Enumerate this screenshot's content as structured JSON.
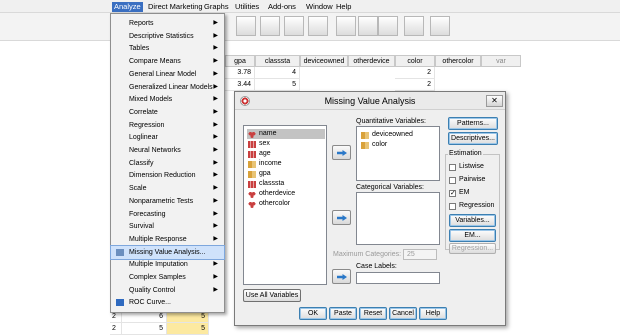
{
  "menubar": {
    "items": [
      "Analyze",
      "Direct Marketing",
      "Graphs",
      "Utilities",
      "Add-ons",
      "Window",
      "Help"
    ]
  },
  "grid": {
    "columns": [
      "gpa",
      "classsta",
      "deviceowned",
      "otherdevice",
      "color",
      "othercolor",
      "var"
    ],
    "rows": [
      {
        "gpa": "3.78",
        "classsta": "4",
        "color": "2"
      },
      {
        "gpa": "3.44",
        "classsta": "5",
        "color": "2"
      }
    ],
    "bottom_rows": [
      {
        "c1": "2",
        "c2": "6",
        "c3": "5"
      },
      {
        "c1": "2",
        "c2": "5",
        "c3": "5"
      }
    ]
  },
  "analyze_menu": {
    "items": [
      {
        "label": "Reports",
        "submenu": true
      },
      {
        "label": "Descriptive Statistics",
        "submenu": true
      },
      {
        "label": "Tables",
        "submenu": true
      },
      {
        "label": "Compare Means",
        "submenu": true
      },
      {
        "label": "General Linear Model",
        "submenu": true
      },
      {
        "label": "Generalized Linear Models",
        "submenu": true
      },
      {
        "label": "Mixed Models",
        "submenu": true
      },
      {
        "label": "Correlate",
        "submenu": true
      },
      {
        "label": "Regression",
        "submenu": true
      },
      {
        "label": "Loglinear",
        "submenu": true
      },
      {
        "label": "Neural Networks",
        "submenu": true
      },
      {
        "label": "Classify",
        "submenu": true
      },
      {
        "label": "Dimension Reduction",
        "submenu": true
      },
      {
        "label": "Scale",
        "submenu": true
      },
      {
        "label": "Nonparametric Tests",
        "submenu": true
      },
      {
        "label": "Forecasting",
        "submenu": true
      },
      {
        "label": "Survival",
        "submenu": true
      },
      {
        "label": "Multiple Response",
        "submenu": true
      },
      {
        "label": "Missing Value Analysis...",
        "submenu": false,
        "highlighted": true
      },
      {
        "label": "Multiple Imputation",
        "submenu": true
      },
      {
        "label": "Complex Samples",
        "submenu": true
      },
      {
        "label": "Quality Control",
        "submenu": true
      },
      {
        "label": "ROC Curve...",
        "submenu": false
      }
    ]
  },
  "dialog": {
    "title": "Missing Value Analysis",
    "close_label": "✕",
    "source_variables": [
      {
        "name": "name",
        "icon": "nominal-icon",
        "selected": true
      },
      {
        "name": "sex",
        "icon": "bar-icon"
      },
      {
        "name": "age",
        "icon": "bar-icon"
      },
      {
        "name": "income",
        "icon": "ruler-icon"
      },
      {
        "name": "gpa",
        "icon": "ruler-icon"
      },
      {
        "name": "classsta",
        "icon": "bar-icon"
      },
      {
        "name": "otherdevice",
        "icon": "nominal-icon"
      },
      {
        "name": "othercolor",
        "icon": "nominal-icon"
      }
    ],
    "quantitative_label": "Quantitative Variables:",
    "quantitative_variables": [
      {
        "name": "deviceowned",
        "icon": "ruler-icon"
      },
      {
        "name": "color",
        "icon": "ruler-icon"
      }
    ],
    "categorical_label": "Categorical Variables:",
    "max_categories_label": "Maximum Categories:",
    "max_categories_value": "25",
    "case_labels_label": "Case Labels:",
    "case_labels_value": "",
    "use_all_label": "Use All Variables",
    "patterns_label": "Patterns...",
    "descriptives_label": "Descriptives...",
    "estimation_label": "Estimation",
    "estimation_options": [
      {
        "label": "Listwise",
        "checked": false
      },
      {
        "label": "Pairwise",
        "checked": false
      },
      {
        "label": "EM",
        "checked": true
      },
      {
        "label": "Regression",
        "checked": false
      }
    ],
    "variables_label": "Variables...",
    "em_label": "EM...",
    "regression_btn_label": "Regression...",
    "footer": [
      "OK",
      "Paste",
      "Reset",
      "Cancel",
      "Help"
    ]
  }
}
